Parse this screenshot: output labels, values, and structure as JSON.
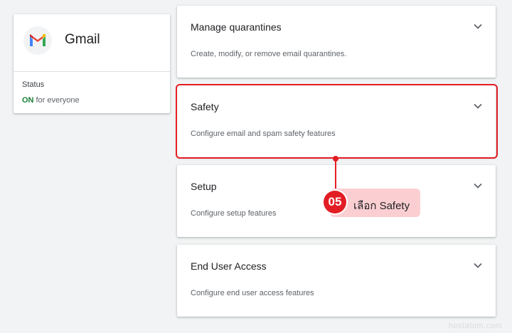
{
  "app": {
    "name": "Gmail",
    "icon": "gmail-logo",
    "status_label": "Status",
    "status_value": "ON",
    "status_scope": "for everyone"
  },
  "sections": [
    {
      "title": "Manage quarantines",
      "description": "Create, modify, or remove email quarantines.",
      "icon": "chevron-down-icon"
    },
    {
      "title": "Safety",
      "description": "Configure email and spam safety features",
      "icon": "chevron-down-icon"
    },
    {
      "title": "Setup",
      "description": "Configure setup features",
      "icon": "chevron-down-icon"
    },
    {
      "title": "End User Access",
      "description": "Configure end user access features",
      "icon": "chevron-down-icon"
    }
  ],
  "callout": {
    "step": "05",
    "text": "เลือก Safety",
    "color": "#e31d24",
    "background": "#fbcfd2"
  },
  "watermark": "hostatom.com",
  "colors": {
    "status_on": "#188038",
    "background": "#f1f3f4"
  }
}
